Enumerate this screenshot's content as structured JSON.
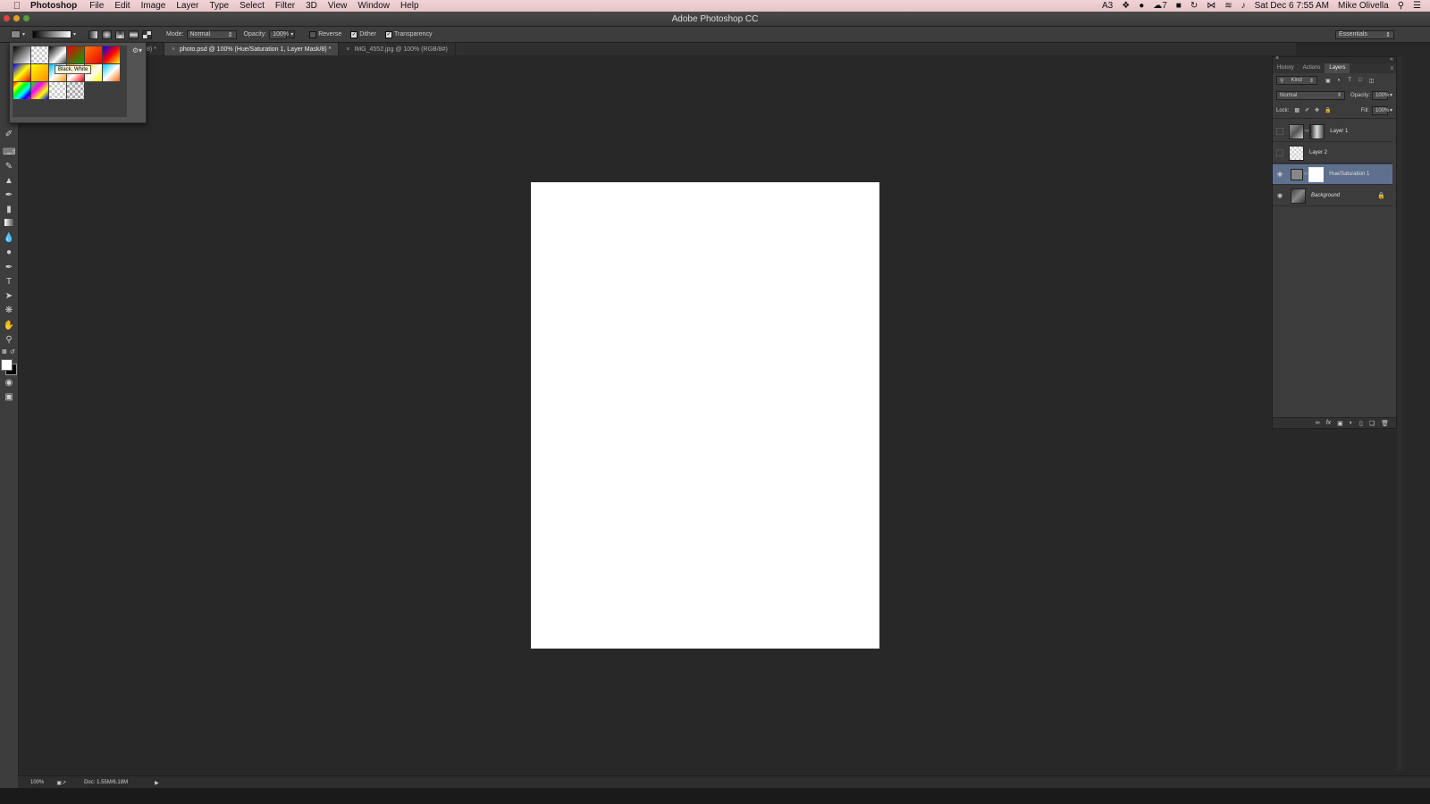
{
  "menubar": {
    "app_name": "Photoshop",
    "items": [
      "File",
      "Edit",
      "Image",
      "Layer",
      "Type",
      "Select",
      "Filter",
      "3D",
      "View",
      "Window",
      "Help"
    ],
    "status_counts": {
      "adobe": "3",
      "creative_cloud": "7"
    },
    "clock": "Sat Dec 6  7:55 AM",
    "user": "Mike Olivella"
  },
  "window": {
    "title": "Adobe Photoshop CC"
  },
  "options_bar": {
    "mode_label": "Mode:",
    "mode_value": "Normal",
    "opacity_label": "Opacity:",
    "opacity_value": "100%",
    "reverse_label": "Reverse",
    "dither_label": "Dither",
    "transparency_label": "Transparency",
    "reverse_checked": false,
    "dither_checked": true,
    "transparency_checked": true,
    "workspace": "Essentials"
  },
  "tabs": {
    "partial": "/8) *",
    "active": "photo.psd @ 100% (Hue/Saturation 1, Layer Mask/8) *",
    "second": "IMG_4552.jpg @ 100% (RGB/8#)"
  },
  "gradient_picker": {
    "tooltip": "Black, White",
    "swatches": [
      "linear-gradient(135deg,#000,#fff)",
      "repeating-conic-gradient(#ccc 0 25%,#fff 0 50%) 0 0/6px 6px",
      "linear-gradient(135deg,#000,#fff 60%,transparent)",
      "linear-gradient(135deg,#e00,#0a0)",
      "linear-gradient(135deg,#ff7a00,#e00)",
      "linear-gradient(135deg,#00f,#f00,#ff0)",
      "linear-gradient(135deg,#00f,#ff0,#f00)",
      "linear-gradient(135deg,#ff0,#f80)",
      "linear-gradient(135deg,#0bf,#fff,#f90)",
      "linear-gradient(135deg,#f80,#fff,#f00)",
      "linear-gradient(135deg,#fc0,#fff,#ff0)",
      "linear-gradient(135deg,#0cf,#fff,#f60)",
      "linear-gradient(135deg,#f00,#ff0,#0f0,#0ff,#00f,#f0f)",
      "linear-gradient(135deg,#0f0,#f0f,#ff0,#00f)",
      "repeating-conic-gradient(#ccc 0 25%,#fff 0 50%) 0 0/6px 6px",
      "repeating-conic-gradient(#aaa 0 25%,#eee 0 50%) 0 0/6px 6px"
    ]
  },
  "layers_panel": {
    "tabs": [
      "History",
      "Actions",
      "Layers"
    ],
    "active_tab": "Layers",
    "filter_kind": "Kind",
    "blend_mode": "Normal",
    "opacity_label": "Opacity:",
    "opacity_value": "100%",
    "lock_label": "Lock:",
    "fill_label": "Fill:",
    "fill_value": "100%",
    "layers": [
      {
        "name": "Layer 1",
        "visible": false,
        "selected": false
      },
      {
        "name": "Layer 2",
        "visible": false,
        "selected": false
      },
      {
        "name": "Hue/Saturation 1",
        "visible": true,
        "selected": true
      },
      {
        "name": "Background",
        "visible": true,
        "selected": false
      }
    ]
  },
  "status": {
    "zoom": "100%",
    "doc": "Doc: 1.55M/6.18M"
  },
  "colors": {
    "canvas_bg": "#282828",
    "document": "#ffffff",
    "selected_layer": "#5e708d"
  }
}
